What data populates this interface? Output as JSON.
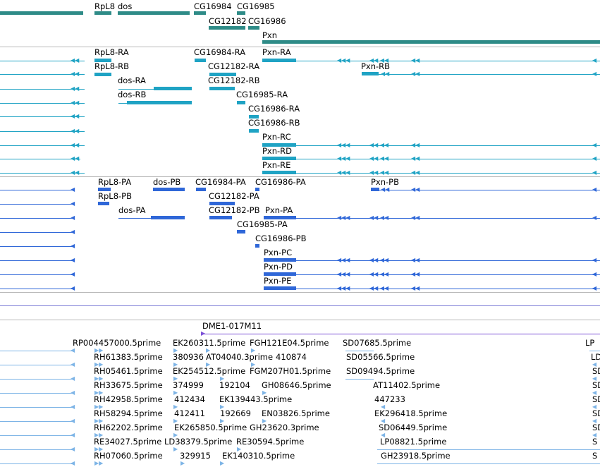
{
  "colors": {
    "gene": "#2e8b87",
    "rna": "#1fa3c4",
    "protein": "#2f67d8",
    "clone": "#7b4fd6",
    "est": "#7db4e6",
    "separator": "#b8b8b8"
  },
  "gene_track": {
    "labels": [
      "RpL8",
      "dos",
      "CG16984",
      "CG16985",
      "CG12182",
      "CG16986",
      "Pxn"
    ]
  },
  "rna_track": {
    "labels": [
      "RpL8-RA",
      "RpL8-RB",
      "dos-RA",
      "dos-RB",
      "CG16984-RA",
      "CG12182-RA",
      "CG12182-RB",
      "CG16985-RA",
      "CG16986-RA",
      "CG16986-RB",
      "Pxn-RA",
      "Pxn-RB",
      "Pxn-RC",
      "Pxn-RD",
      "Pxn-RE"
    ]
  },
  "protein_track": {
    "labels": [
      "RpL8-PA",
      "RpL8-PB",
      "dos-PA",
      "dos-PB",
      "CG16984-PA",
      "CG12182-PA",
      "CG12182-PB",
      "CG16985-PA",
      "CG16986-PA",
      "CG16986-PB",
      "Pxn-PA",
      "Pxn-PB",
      "Pxn-PC",
      "Pxn-PD",
      "Pxn-PE"
    ]
  },
  "clone_track": {
    "labels": [
      "DME1-017M11"
    ]
  },
  "est_track": {
    "labels": [
      "RP004457000.5prime",
      "RH61383.5prime",
      "RH05461.5prime",
      "RH33675.5prime",
      "RH42958.5prime",
      "RH58294.5prime",
      "RH62202.5prime",
      "RE34027.5prime",
      "RH07060.5prime",
      "EK260311.5prime",
      "380936",
      "EK254512.5prime",
      "374999",
      "412434",
      "412411",
      "EK265850.5prime",
      "LD38379.5prime",
      "329915",
      "AT04040.3prime",
      "410874",
      "192104",
      "EK139443.5prime",
      "192669",
      "GH23620.3prime",
      "RE30594.5prime",
      "EK140310.5prime",
      "FGH121E04.5prime",
      "FGM207H01.5prime",
      "GH08646.5prime",
      "EN03826.5prime",
      "SD07685.5prime",
      "SD05566.5prime",
      "SD09494.5prime",
      "AT11402.5prime",
      "447233",
      "EK296418.5prime",
      "SD06449.5prime",
      "LP08821.5prime",
      "GH23918.5prime",
      "LP",
      "LD",
      "SD",
      "SD",
      "SD",
      "SD",
      "SD",
      "S",
      "S"
    ]
  }
}
